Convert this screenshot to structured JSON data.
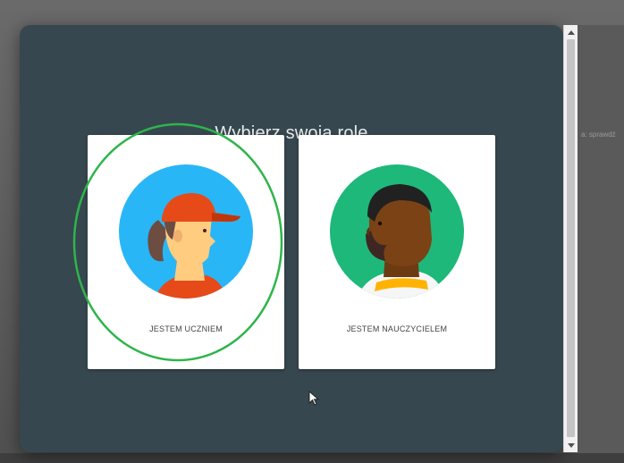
{
  "dialog": {
    "title": "Wybierz swoją rolę"
  },
  "roles": [
    {
      "label": "JESTEM UCZNIEM",
      "avatar": "student-avatar-icon",
      "accent": "#29b6f6"
    },
    {
      "label": "JESTEM NAUCZYCIELEM",
      "avatar": "teacher-avatar-icon",
      "accent": "#1db87a"
    }
  ],
  "background": {
    "side_text": "a: sprawdź"
  },
  "colors": {
    "dialog_bg": "#37474f",
    "highlight": "#2eb54a"
  },
  "icons": {
    "scroll_up": "chevron-up-icon",
    "scroll_down": "chevron-down-icon",
    "cursor": "mouse-pointer-icon"
  }
}
